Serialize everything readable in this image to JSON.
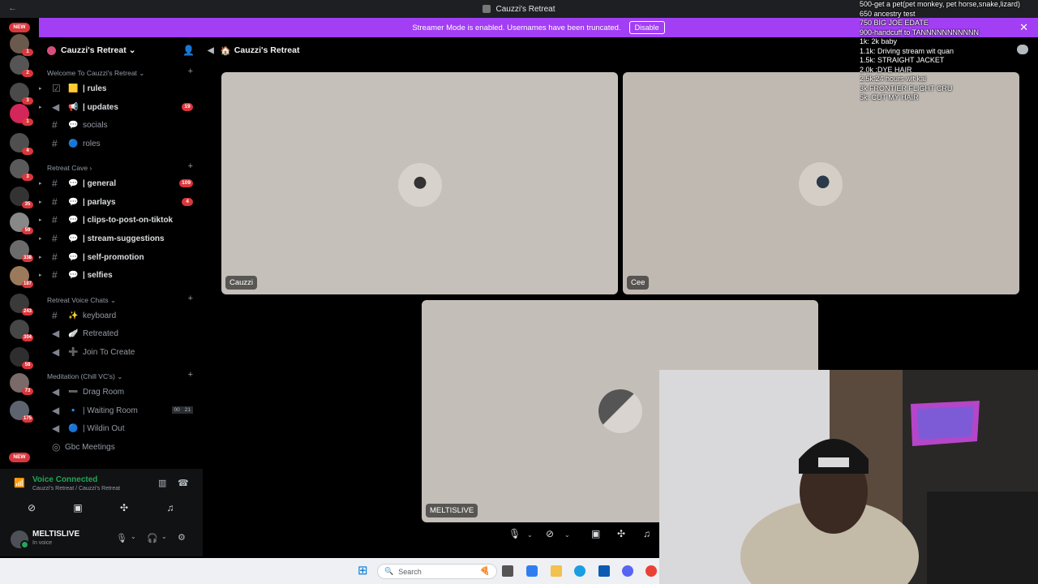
{
  "window": {
    "title": "Cauzzi's Retreat",
    "back_glyph": "←"
  },
  "banner": {
    "text": "Streamer Mode is enabled. Usernames have been truncated.",
    "disable_label": "Disable",
    "close_glyph": "✕"
  },
  "rail": {
    "badges": [
      "1",
      "2",
      "3",
      "1",
      "4",
      "3",
      "35",
      "59",
      "338",
      "187",
      "243",
      "304",
      "58",
      "73",
      "175"
    ],
    "new_label_top": "NEW",
    "new_label_bottom": "NEW"
  },
  "server": {
    "name": "Cauzzi's Retreat",
    "chevron": "⌄",
    "invite_glyph": "👤"
  },
  "categories": {
    "welcome": "Welcome To Cauzzi's Retreat",
    "cave": "Retreat Cave",
    "voice": "Retreat Voice Chats",
    "meditation": "Meditation (Chill VC's)",
    "add_glyph": "+",
    "chev_down": "⌄",
    "chev_right": "›"
  },
  "channels": {
    "rules": {
      "emoji": "🟨",
      "name": "| rules"
    },
    "updates": {
      "emoji": "📢",
      "name": "| updates",
      "badge": "19"
    },
    "socials": {
      "emoji": "💬",
      "name": "socials"
    },
    "roles": {
      "emoji": "🔵",
      "name": "roles"
    },
    "general": {
      "emoji": "💬",
      "name": "| general",
      "badge": "109"
    },
    "parlays": {
      "emoji": "💬",
      "name": "| parlays",
      "badge": "4"
    },
    "clips": {
      "emoji": "💬",
      "name": "| clips-to-post-on-tiktok"
    },
    "suggestions": {
      "emoji": "💬",
      "name": "| stream-suggestions"
    },
    "promo": {
      "emoji": "💬",
      "name": "| self-promotion"
    },
    "selfies": {
      "emoji": "💬",
      "name": "| selfies"
    },
    "keyboard": {
      "emoji": "✨",
      "name": "keyboard"
    },
    "retreated": {
      "emoji": "🪽",
      "name": "Retreated"
    },
    "join": {
      "emoji": "➕",
      "name": "Join To Create"
    },
    "drag": {
      "emoji": "➖",
      "name": "Drag Room"
    },
    "waiting": {
      "emoji": "",
      "name": "| Waiting Room",
      "count_a": "00",
      "count_b": "21"
    },
    "wildin": {
      "emoji": "🔵",
      "name": "| Wildin Out"
    },
    "gbc": {
      "emoji": "",
      "name": "Gbc Meetings"
    }
  },
  "voice_panel": {
    "status": "Voice Connected",
    "location": "Cauzzi's Retreat / Cauzzi's Retreat",
    "username": "MELTISLIVE",
    "user_status": "In voice"
  },
  "stage": {
    "title": "Cauzzi's Retreat",
    "tiles": [
      {
        "name": "Cauzzi",
        "bg": "#c5c0ba"
      },
      {
        "name": "Cee",
        "bg": "#bfb9b2"
      },
      {
        "name": "MELTISLIVE",
        "bg": "#c4beb8"
      }
    ]
  },
  "goals": [
    "500-get a pet(pet monkey, pet horse,snake,lizard)",
    "650 ancestry test",
    "750 BIG JOE EDATE",
    "900-handcuff to TANNNNNNNNNNN",
    "1k: 2k baby",
    "1.1k: Driving stream wit quan",
    "1.5k: STRAIGHT JACKET",
    "2.0k :DYE HAIR",
    "2.5k:24 hours wit kai",
    "3k FRONTIER FLIGHT CRU",
    "5k: CUT MY HAIR"
  ],
  "taskbar": {
    "search_placeholder": "Search",
    "start_glyph": "⊞",
    "search_glyph": "🔍"
  },
  "colors": {
    "banner": "#a23ef4",
    "voice_green": "#23a55a",
    "badge_red": "#da373c"
  }
}
